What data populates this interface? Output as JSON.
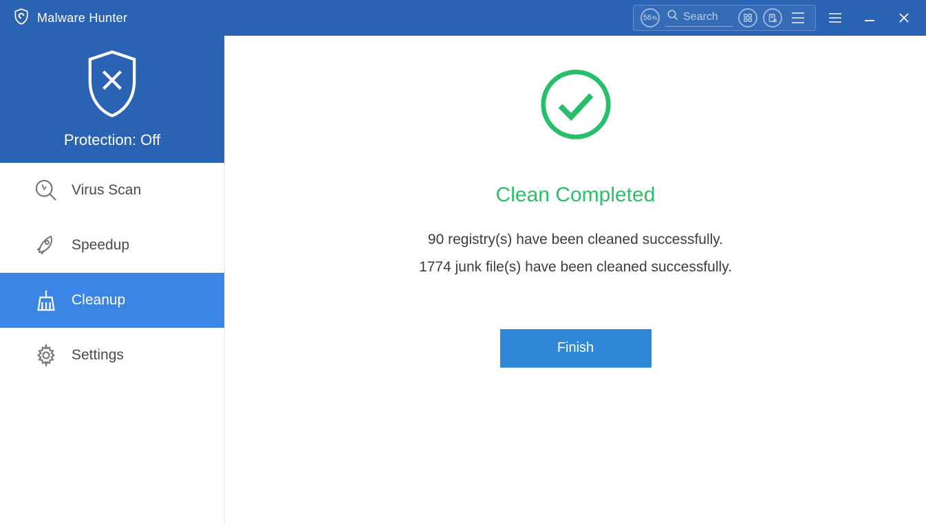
{
  "app": {
    "title": "Malware Hunter"
  },
  "titlebar": {
    "progress_percent": "56",
    "percent_symbol": "%",
    "search_placeholder": "Search"
  },
  "sidebar": {
    "protection_label": "Protection: Off",
    "items": [
      {
        "label": "Virus Scan"
      },
      {
        "label": "Speedup"
      },
      {
        "label": "Cleanup"
      },
      {
        "label": "Settings"
      }
    ]
  },
  "main": {
    "title": "Clean Completed",
    "line1": "90 registry(s) have been cleaned successfully.",
    "line2": "1774 junk file(s) have been cleaned successfully.",
    "finish_label": "Finish"
  },
  "colors": {
    "brand_blue": "#2a62b4",
    "accent_blue": "#3a85e6",
    "success_green": "#29bf6a",
    "button_blue": "#2f87d6"
  }
}
